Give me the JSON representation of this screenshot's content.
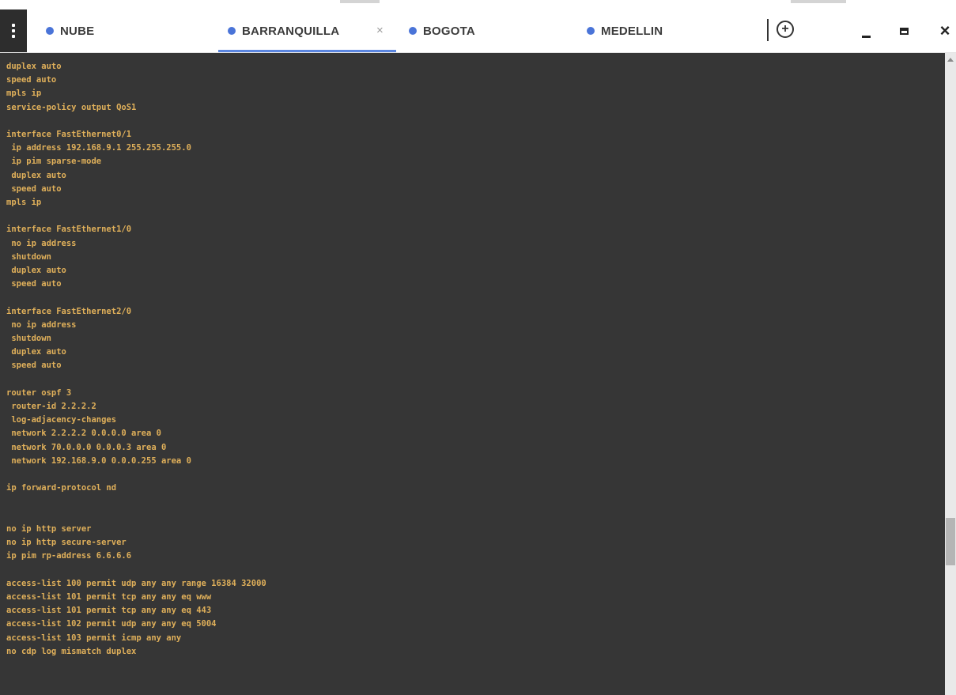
{
  "tabs": [
    {
      "label": "NUBE",
      "active": false
    },
    {
      "label": "BARRANQUILLA",
      "active": true
    },
    {
      "label": "BOGOTA",
      "active": false
    },
    {
      "label": "MEDELLIN",
      "active": false
    }
  ],
  "tab_close_glyph": "×",
  "window_controls": {
    "add": "+",
    "close": "×"
  },
  "terminal": {
    "lines": [
      "duplex auto",
      "speed auto",
      "mpls ip",
      "service-policy output QoS1",
      "",
      "interface FastEthernet0/1",
      " ip address 192.168.9.1 255.255.255.0",
      " ip pim sparse-mode",
      " duplex auto",
      " speed auto",
      "mpls ip",
      "",
      "interface FastEthernet1/0",
      " no ip address",
      " shutdown",
      " duplex auto",
      " speed auto",
      "",
      "interface FastEthernet2/0",
      " no ip address",
      " shutdown",
      " duplex auto",
      " speed auto",
      "",
      "router ospf 3",
      " router-id 2.2.2.2",
      " log-adjacency-changes",
      " network 2.2.2.2 0.0.0.0 area 0",
      " network 70.0.0.0 0.0.0.3 area 0",
      " network 192.168.9.0 0.0.0.255 area 0",
      "",
      "ip forward-protocol nd",
      "",
      "",
      "no ip http server",
      "no ip http secure-server",
      "ip pim rp-address 6.6.6.6",
      "",
      "access-list 100 permit udp any any range 16384 32000",
      "access-list 101 permit tcp any any eq www",
      "access-list 101 permit tcp any any eq 443",
      "access-list 102 permit udp any any eq 5004",
      "access-list 103 permit icmp any any",
      "no cdp log mismatch duplex"
    ]
  },
  "colors": {
    "terminal_bg": "#363636",
    "terminal_text": "#e0b05a",
    "tab_dot": "#4a74d8",
    "active_underline": "#5b86e0"
  }
}
